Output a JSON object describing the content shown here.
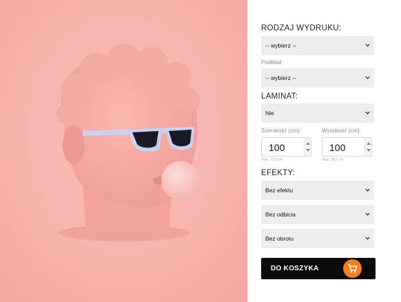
{
  "image": {
    "alt_icon": "bust-with-sunglasses-bubblegum-image"
  },
  "print_type": {
    "heading": "RODZAJ WYDRUKU:",
    "value": "-- wybierz --"
  },
  "base": {
    "label": "Podkład:",
    "value": "-- wybierz --"
  },
  "laminate": {
    "heading": "LAMINAT:",
    "value": "Nie"
  },
  "dimensions": {
    "width": {
      "label": "Szerokość (cm):",
      "value": "100",
      "hint": "max: 713 cm"
    },
    "height": {
      "label": "Wysokość (cm):",
      "value": "100",
      "hint": "max: 567 cm"
    }
  },
  "effects": {
    "heading": "EFEKTY:",
    "effect_value": "Bez efektu",
    "reflection_value": "Bez odbicia",
    "rotation_value": "Bez obrotu"
  },
  "cart": {
    "label": "DO KOSZYKA",
    "icon": "cart-icon",
    "accent": "#f57f22"
  },
  "colors": {
    "image_bg": "#f8b3ae",
    "select_bg": "#ededf0",
    "button_bg": "#0b0b0b"
  }
}
